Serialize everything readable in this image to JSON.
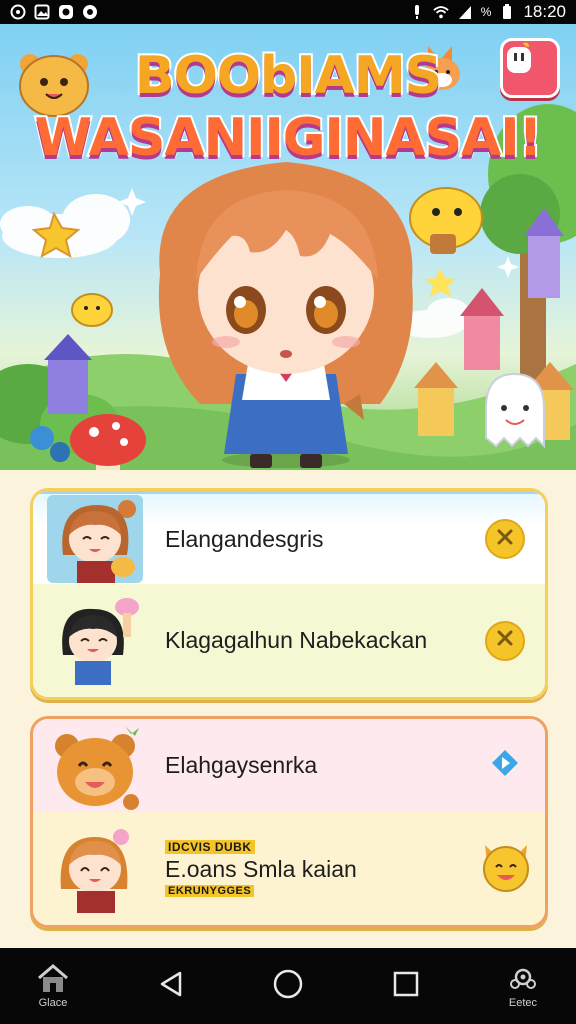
{
  "status_bar": {
    "time": "18:20",
    "battery_text": "%",
    "left_icons": [
      "circle-icon",
      "gallery-icon",
      "whatsapp-icon",
      "record-icon"
    ],
    "right_icons": [
      "mute-icon",
      "wifi-icon",
      "signal-icon",
      "battery-icon"
    ]
  },
  "hero": {
    "title_line1": "BOObIAMS",
    "title_line2": "WASANIIGINASAI!",
    "menu_icon": "app-icon"
  },
  "list": {
    "group1": [
      {
        "label": "Elangandesgris",
        "action": "close-icon"
      },
      {
        "label": "Klagagalhun Nabekackan",
        "action": "close-icon"
      }
    ],
    "group2": [
      {
        "label": "Elahgaysenrka",
        "action": "play-icon"
      },
      {
        "label": "E.oans Smla kaian",
        "badge_top": "IDCVIS DUBK",
        "badge_bottom": "EKRUNYGGES",
        "action": "fox-icon"
      }
    ]
  },
  "navbar": {
    "left_label": "Glace",
    "right_label": "Eetec"
  },
  "colors": {
    "accent_yellow": "#f5c428",
    "accent_pink": "#f0566c",
    "play_blue": "#3ba7e8"
  }
}
